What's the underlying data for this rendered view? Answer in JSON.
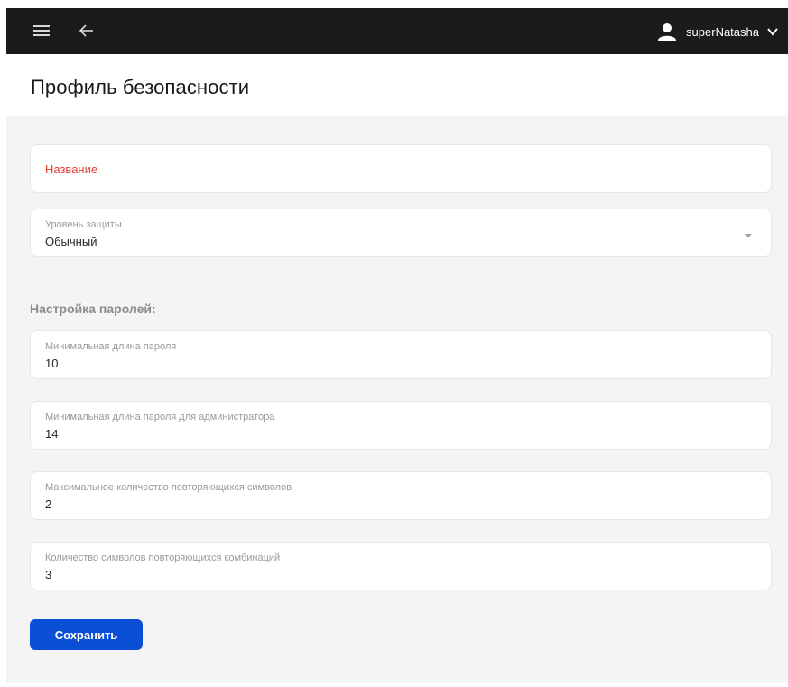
{
  "topbar": {
    "username": "superNatasha",
    "icons": [
      "menu-icon",
      "back-arrow-icon",
      "user-icon",
      "chevron-down-icon"
    ],
    "background_color": "#1b1b1b"
  },
  "header": {
    "title": "Профиль безопасности"
  },
  "form": {
    "name_field": {
      "placeholder": "Название",
      "placeholder_color": "#e53935"
    },
    "protection_level": {
      "label": "Уровень защиты",
      "value": "Обычный"
    },
    "password_section_title": "Настройка паролей:",
    "fields": [
      {
        "label": "Минимальная длина пароля",
        "value": "10"
      },
      {
        "label": "Минимальная длина пароля для администратора",
        "value": "14"
      },
      {
        "label": "Максимальное количество повторяющихся символов",
        "value": "2"
      },
      {
        "label": "Количество символов повторяющихся комбинаций",
        "value": "3"
      }
    ],
    "save_label": "Сохранить",
    "save_color": "#0a4fd6"
  }
}
